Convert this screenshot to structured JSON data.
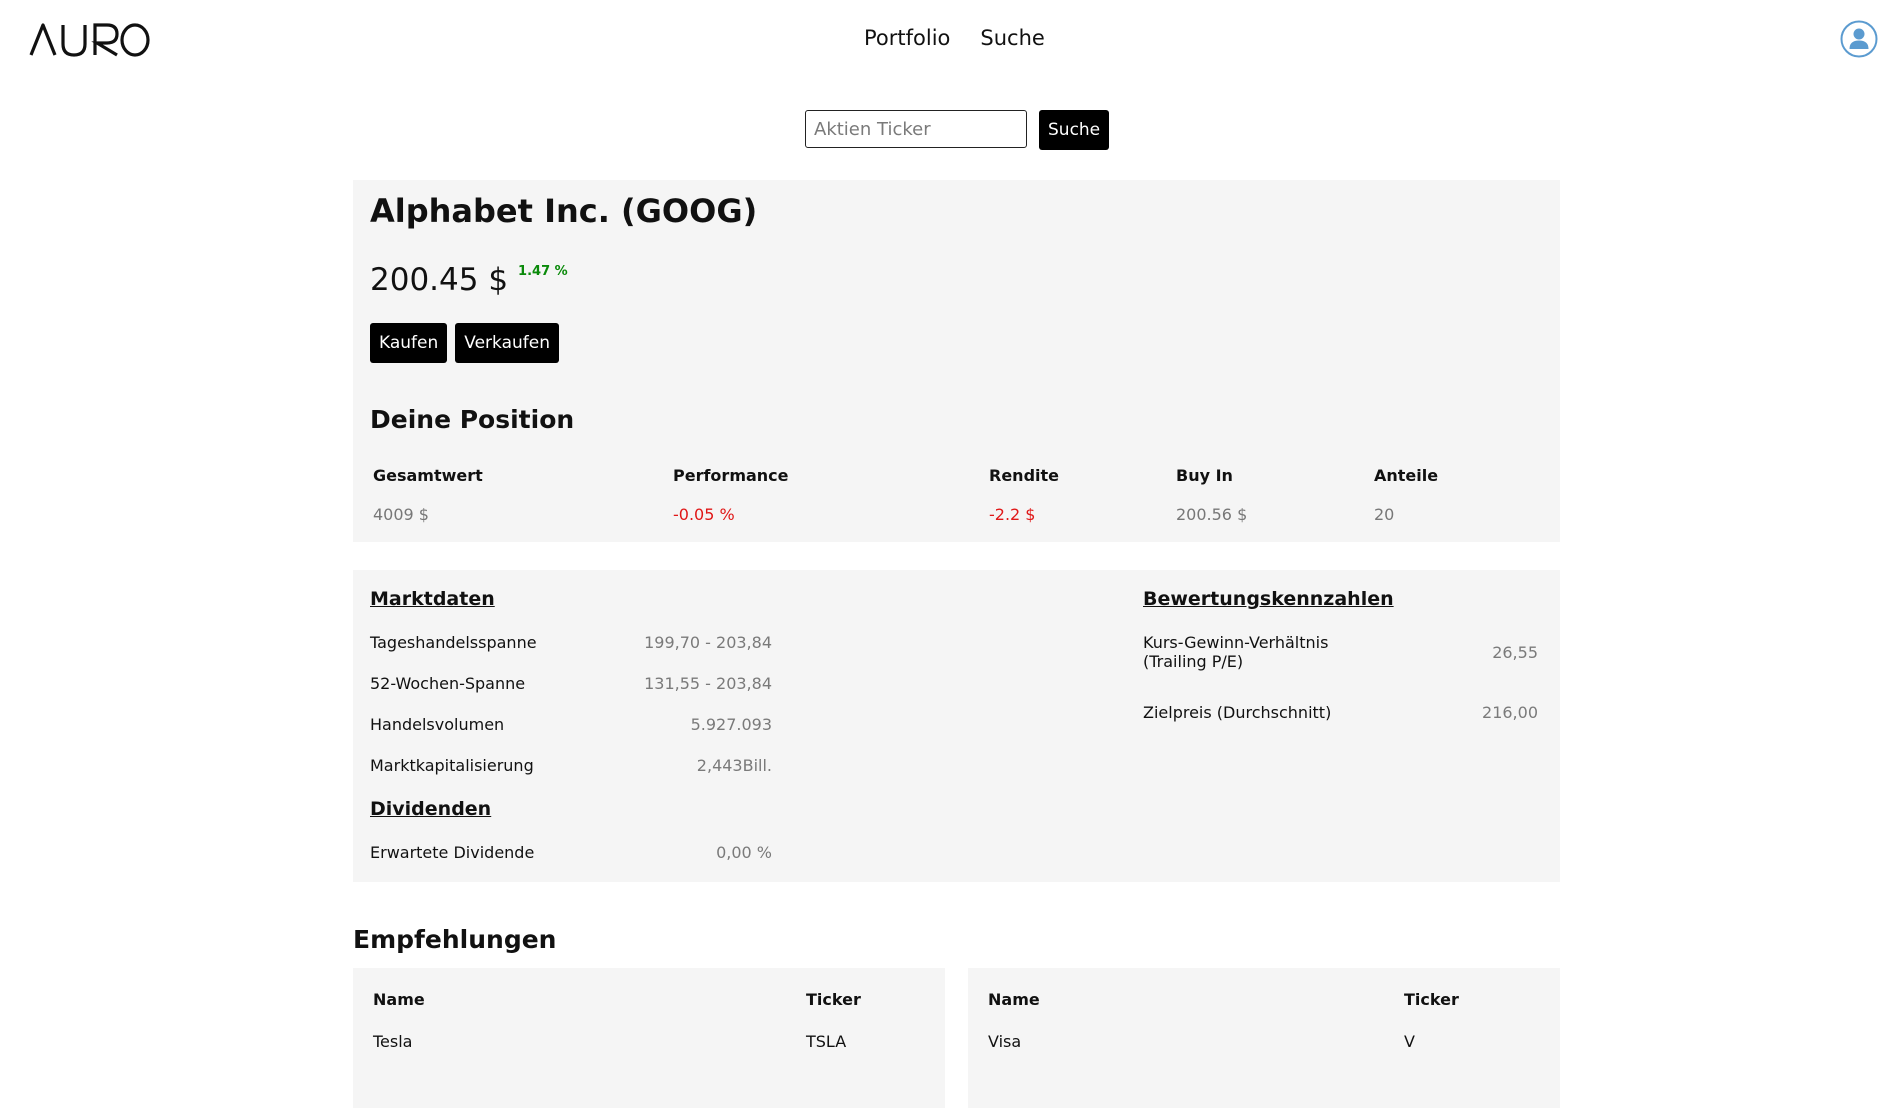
{
  "header": {
    "logo": "AURO",
    "nav": [
      "Portfolio",
      "Suche"
    ]
  },
  "search": {
    "placeholder": "Aktien Ticker",
    "button": "Suche"
  },
  "stock": {
    "title": "Alphabet Inc. (GOOG)",
    "price": "200.45 $",
    "change": "1.47 %",
    "buy_label": "Kaufen",
    "sell_label": "Verkaufen"
  },
  "position": {
    "title": "Deine Position",
    "columns": [
      {
        "label": "Gesamtwert",
        "value": "4009 $"
      },
      {
        "label": "Performance",
        "value": "-0.05 %"
      },
      {
        "label": "Rendite",
        "value": "-2.2 $"
      },
      {
        "label": "Buy In",
        "value": "200.56 $"
      },
      {
        "label": "Anteile",
        "value": "20"
      }
    ]
  },
  "marktdaten": {
    "title": "Marktdaten",
    "rows": [
      {
        "label": "Tageshandelsspanne",
        "value": "199,70 - 203,84"
      },
      {
        "label": "52-Wochen-Spanne",
        "value": "131,55 - 203,84"
      },
      {
        "label": "Handelsvolumen",
        "value": "5.927.093"
      },
      {
        "label": "Marktkapitalisierung",
        "value": "2,443Bill."
      }
    ]
  },
  "dividenden": {
    "title": "Dividenden",
    "rows": [
      {
        "label": "Erwartete Dividende",
        "value": "0,00 %"
      }
    ]
  },
  "bewertung": {
    "title": "Bewertungskennzahlen",
    "rows": [
      {
        "label_line1": "Kurs-Gewinn-Verhältnis",
        "label_line2": "(Trailing P/E)",
        "value": "26,55"
      },
      {
        "label": "Zielpreis (Durchschnitt)",
        "value": "216,00"
      }
    ]
  },
  "empfehlungen": {
    "title": "Empfehlungen",
    "cards": [
      {
        "head_name": "Name",
        "head_ticker": "Ticker",
        "rows": [
          {
            "name": "Tesla",
            "ticker": "TSLA"
          }
        ]
      },
      {
        "head_name": "Name",
        "head_ticker": "Ticker",
        "rows": [
          {
            "name": "Visa",
            "ticker": "V"
          }
        ]
      }
    ]
  },
  "colors": {
    "positive": "#0a8a0a",
    "negative": "#e01818",
    "panel_bg": "#f5f5f5",
    "button_bg": "#000000"
  }
}
